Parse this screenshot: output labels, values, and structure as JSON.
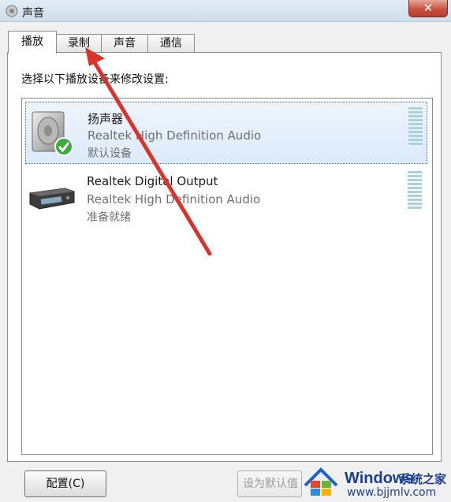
{
  "window": {
    "title": "声音"
  },
  "tabs": [
    {
      "label": "播放",
      "active": true
    },
    {
      "label": "录制",
      "active": false
    },
    {
      "label": "声音",
      "active": false
    },
    {
      "label": "通信",
      "active": false
    }
  ],
  "panel": {
    "instruction": "选择以下播放设备来修改设置:"
  },
  "devices": [
    {
      "name": "扬声器",
      "description": "Realtek High Definition Audio",
      "status": "默认设备",
      "icon": "speaker-icon",
      "default": true,
      "selected": true
    },
    {
      "name": "Realtek Digital Output",
      "description": "Realtek High Definition Audio",
      "status": "准备就绪",
      "icon": "digital-output-icon",
      "default": false,
      "selected": false
    }
  ],
  "buttons": {
    "configure": "配置(C)",
    "set_default": "设为默认值"
  },
  "watermark": {
    "brand": "Windows",
    "site": "系统之家",
    "url": "www.bjjmlv.com"
  },
  "colors": {
    "accent": "#3a6fb7",
    "annotation_arrow": "#d9342b",
    "close": "#c7503f",
    "meter": "#a9d2da"
  }
}
